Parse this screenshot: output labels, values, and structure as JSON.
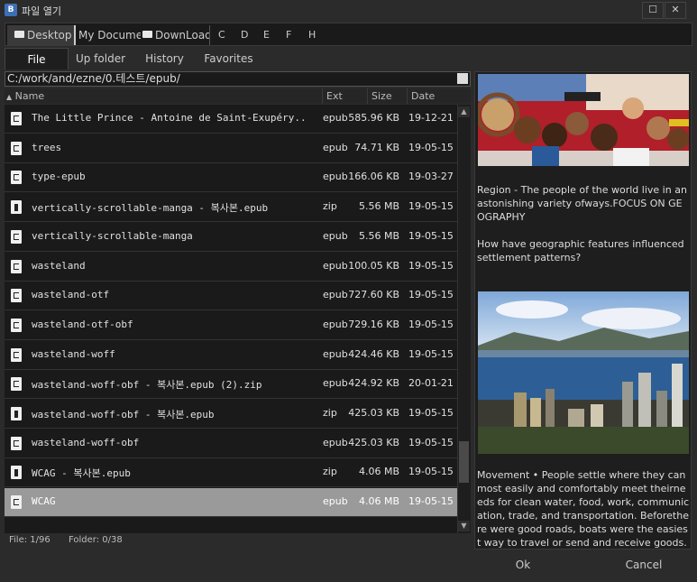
{
  "window": {
    "title": "파일 열기",
    "app_icon_glyph": "B",
    "maximize_glyph": "☐",
    "close_glyph": "✕"
  },
  "locations": [
    {
      "label": "Desktop"
    },
    {
      "label": "My Documents"
    },
    {
      "label": "DownLoads"
    }
  ],
  "drives": [
    "C",
    "D",
    "E",
    "F",
    "H"
  ],
  "tabs": [
    {
      "label": "File",
      "active": true
    },
    {
      "label": "Up folder"
    },
    {
      "label": "History"
    },
    {
      "label": "Favorites"
    }
  ],
  "path": "C:/work/and/ezne/0.테스트/epub/",
  "columns": {
    "name": "Name",
    "ext": "Ext",
    "size": "Size",
    "date": "Date",
    "sort_glyph": "▲"
  },
  "files": [
    {
      "name": "The Little Prince - Antoine de Saint-Exupéry..",
      "ext": "epub",
      "size": "585.96 KB",
      "date": "19-12-21",
      "icon": "epub-file-icon"
    },
    {
      "name": "trees",
      "ext": "epub",
      "size": "74.71 KB",
      "date": "19-05-15",
      "icon": "epub-file-icon"
    },
    {
      "name": "type-epub",
      "ext": "epub",
      "size": "166.06 KB",
      "date": "19-03-27",
      "icon": "epub-file-icon"
    },
    {
      "name": "vertically-scrollable-manga - 복사본.epub",
      "ext": "zip",
      "size": "5.56 MB",
      "date": "19-05-15",
      "icon": "zip-file-icon"
    },
    {
      "name": "vertically-scrollable-manga",
      "ext": "epub",
      "size": "5.56 MB",
      "date": "19-05-15",
      "icon": "epub-file-icon"
    },
    {
      "name": "wasteland",
      "ext": "epub",
      "size": "100.05 KB",
      "date": "19-05-15",
      "icon": "epub-file-icon"
    },
    {
      "name": "wasteland-otf",
      "ext": "epub",
      "size": "727.60 KB",
      "date": "19-05-15",
      "icon": "epub-file-icon"
    },
    {
      "name": "wasteland-otf-obf",
      "ext": "epub",
      "size": "729.16 KB",
      "date": "19-05-15",
      "icon": "epub-file-icon"
    },
    {
      "name": "wasteland-woff",
      "ext": "epub",
      "size": "424.46 KB",
      "date": "19-05-15",
      "icon": "epub-file-icon"
    },
    {
      "name": "wasteland-woff-obf - 복사본.epub (2).zip",
      "ext": "epub",
      "size": "424.92 KB",
      "date": "20-01-21",
      "icon": "epub-file-icon"
    },
    {
      "name": "wasteland-woff-obf - 복사본.epub",
      "ext": "zip",
      "size": "425.03 KB",
      "date": "19-05-15",
      "icon": "zip-file-icon"
    },
    {
      "name": "wasteland-woff-obf",
      "ext": "epub",
      "size": "425.03 KB",
      "date": "19-05-15",
      "icon": "epub-file-icon"
    },
    {
      "name": "WCAG - 복사본.epub",
      "ext": "zip",
      "size": "4.06 MB",
      "date": "19-05-15",
      "icon": "zip-file-icon"
    },
    {
      "name": "WCAG",
      "ext": "epub",
      "size": "4.06 MB",
      "date": "19-05-15",
      "icon": "epub-file-icon",
      "selected": true
    }
  ],
  "scrollbar": {
    "up_glyph": "▲",
    "down_glyph": "▼"
  },
  "status": {
    "file": "File: 1/96",
    "folder": "Folder: 0/38"
  },
  "preview": {
    "paragraph1": "Region - The people of the world live in an astonishing variety ofways.FOCUS ON GEOGRAPHY",
    "paragraph2": "How have geographic features influenced settlement patterns?",
    "paragraph3": "Movement • People settle where they can most easily and comfortably meet theirneeds for clean water, food, work, communication, trade, and transportation. Beforethere were good roads, boats were the easiest way to travel or send and receive goods.As a r"
  },
  "buttons": {
    "ok": "Ok",
    "cancel": "Cancel"
  }
}
